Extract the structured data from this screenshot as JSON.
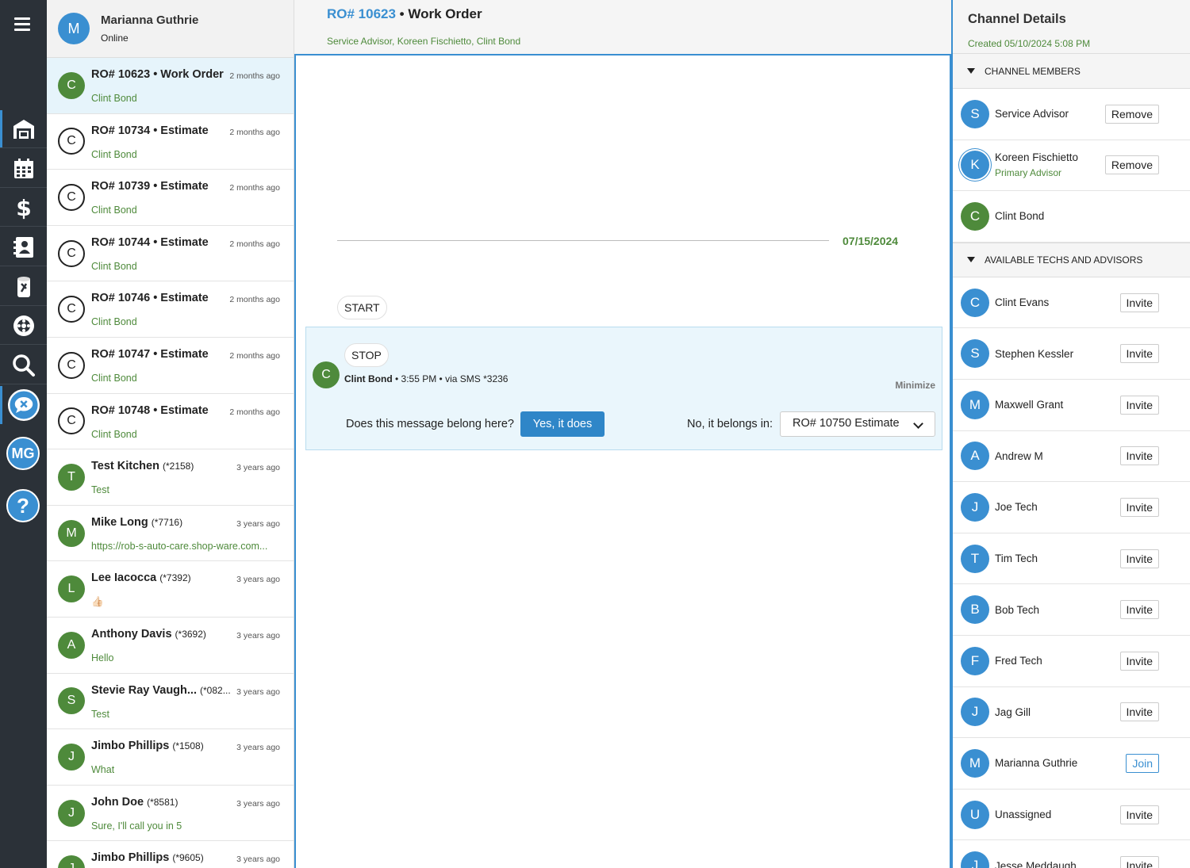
{
  "rail": {
    "profile_initials": "MG"
  },
  "me": {
    "initial": "M",
    "name": "Marianna Guthrie",
    "status": "Online"
  },
  "conversations": [
    {
      "initial": "C",
      "title": "RO# 10623 • Work Order",
      "phone": "",
      "time": "2 months ago",
      "sub": "Clint Bond",
      "style": "green",
      "selected": true
    },
    {
      "initial": "C",
      "title": "RO# 10734 • Estimate",
      "phone": "",
      "time": "2 months ago",
      "sub": "Clint Bond",
      "style": "outline"
    },
    {
      "initial": "C",
      "title": "RO# 10739 • Estimate",
      "phone": "",
      "time": "2 months ago",
      "sub": "Clint Bond",
      "style": "outline"
    },
    {
      "initial": "C",
      "title": "RO# 10744 • Estimate",
      "phone": "",
      "time": "2 months ago",
      "sub": "Clint Bond",
      "style": "outline"
    },
    {
      "initial": "C",
      "title": "RO# 10746 • Estimate",
      "phone": "",
      "time": "2 months ago",
      "sub": "Clint Bond",
      "style": "outline"
    },
    {
      "initial": "C",
      "title": "RO# 10747 • Estimate",
      "phone": "",
      "time": "2 months ago",
      "sub": "Clint Bond",
      "style": "outline"
    },
    {
      "initial": "C",
      "title": "RO# 10748 • Estimate",
      "phone": "",
      "time": "2 months ago",
      "sub": "Clint Bond",
      "style": "outline"
    },
    {
      "initial": "T",
      "title": "Test Kitchen",
      "phone": "(*2158)",
      "time": "3 years ago",
      "sub": "Test",
      "style": "green"
    },
    {
      "initial": "M",
      "title": "Mike Long",
      "phone": "(*7716)",
      "time": "3 years ago",
      "sub": "https://rob-s-auto-care.shop-ware.com...",
      "style": "green"
    },
    {
      "initial": "L",
      "title": "Lee Iacocca",
      "phone": "(*7392)",
      "time": "3 years ago",
      "sub": "👍🏻",
      "style": "green"
    },
    {
      "initial": "A",
      "title": "Anthony Davis",
      "phone": "(*3692)",
      "time": "3 years ago",
      "sub": "Hello",
      "style": "green"
    },
    {
      "initial": "S",
      "title": "Stevie Ray Vaugh...",
      "phone": "(*082...",
      "time": "3 years ago",
      "sub": "Test",
      "style": "green"
    },
    {
      "initial": "J",
      "title": "Jimbo Phillips",
      "phone": "(*1508)",
      "time": "3 years ago",
      "sub": "What",
      "style": "green"
    },
    {
      "initial": "J",
      "title": "John Doe",
      "phone": "(*8581)",
      "time": "3 years ago",
      "sub": "Sure, I'll call you in 5",
      "style": "green"
    },
    {
      "initial": "J",
      "title": "Jimbo Phillips",
      "phone": "(*9605)",
      "time": "3 years ago",
      "sub": "",
      "style": "green"
    }
  ],
  "channel": {
    "ro": "RO# 10623",
    "sep": " • ",
    "type": "Work Order",
    "members": "Service Advisor, Koreen Fischietto, Clint Bond",
    "date": "07/15/2024",
    "start_label": "START",
    "message": {
      "text": "STOP",
      "author_initial": "C",
      "author": "Clint Bond",
      "meta": " • 3:55 PM • via SMS *3236",
      "minimize": "Minimize",
      "question": "Does this message belong here?",
      "yes": "Yes, it does",
      "no": "No, it belongs in:",
      "select_value": "RO# 10750 Estimate"
    }
  },
  "details": {
    "title": "Channel Details",
    "created": "Created 05/10/2024 5:08 PM",
    "members_label": "CHANNEL MEMBERS",
    "available_label": "AVAILABLE TECHS AND ADVISORS",
    "members": [
      {
        "initial": "S",
        "name": "Service Advisor",
        "role": "",
        "action": "Remove",
        "color": "blue"
      },
      {
        "initial": "K",
        "name": "Koreen Fischietto",
        "role": "Primary Advisor",
        "action": "Remove",
        "color": "blue",
        "ring": true
      },
      {
        "initial": "C",
        "name": "Clint Bond",
        "role": "",
        "action": "",
        "color": "green"
      }
    ],
    "available": [
      {
        "initial": "C",
        "name": "Clint Evans",
        "action": "Invite"
      },
      {
        "initial": "S",
        "name": "Stephen Kessler",
        "action": "Invite"
      },
      {
        "initial": "M",
        "name": "Maxwell Grant",
        "action": "Invite"
      },
      {
        "initial": "A",
        "name": "Andrew M",
        "action": "Invite"
      },
      {
        "initial": "J",
        "name": "Joe Tech",
        "action": "Invite"
      },
      {
        "initial": "T",
        "name": "Tim Tech",
        "action": "Invite"
      },
      {
        "initial": "B",
        "name": "Bob Tech",
        "action": "Invite"
      },
      {
        "initial": "F",
        "name": "Fred Tech",
        "action": "Invite"
      },
      {
        "initial": "J",
        "name": "Jag Gill",
        "action": "Invite"
      },
      {
        "initial": "M",
        "name": "Marianna Guthrie",
        "action": "Join"
      },
      {
        "initial": "U",
        "name": "Unassigned",
        "action": "Invite"
      },
      {
        "initial": "J",
        "name": "Jesse Meddaugh",
        "action": "Invite"
      }
    ]
  }
}
